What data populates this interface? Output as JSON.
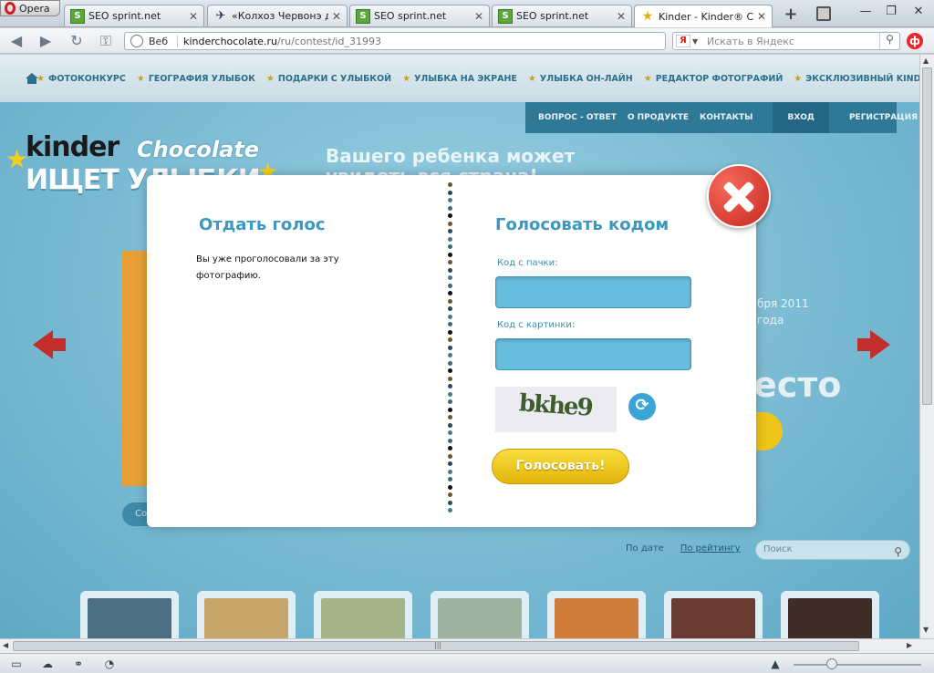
{
  "browser": {
    "menu_label": "Opera",
    "tabs": [
      {
        "title": "SEO sprint.net",
        "icon": "seo-favicon"
      },
      {
        "title": "«Колхоз Червонэ д…",
        "icon": "bird-favicon"
      },
      {
        "title": "SEO sprint.net",
        "icon": "seo-favicon"
      },
      {
        "title": "SEO sprint.net",
        "icon": "seo-favicon"
      },
      {
        "title": "Kinder - Kinder® Ch…",
        "icon": "star-favicon"
      }
    ],
    "address": {
      "label": "Веб",
      "host": "kinderchocolate.ru",
      "path": "/ru/contest/id_31993"
    },
    "search_placeholder": "Искать в Яндекс",
    "search_engine_badge": "Я"
  },
  "site": {
    "nav": [
      "ФОТОКОНКУРС",
      "ГЕОГРАФИЯ УЛЫБОК",
      "ПОДАРКИ С УЛЫБКОЙ",
      "УЛЫБКА НА ЭКРАНЕ",
      "УЛЫБКА ОН-ЛАЙН",
      "РЕДАКТОР ФОТОГРАФИЙ",
      "ЭКСКЛЮЗИВНЫЙ KINDER® CHOCOLATE"
    ],
    "usermenu": {
      "qa": "ВОПРОС - ОТВЕТ",
      "about": "О ПРОДУКТЕ",
      "contacts": "КОНТАКТЫ",
      "login": "ВХОД",
      "register": "РЕГИСТРАЦИЯ"
    },
    "logo": {
      "brand": "kinder",
      "product": "Chocolate",
      "tagline": "ИЩЕТ УЛЫБКИ"
    },
    "headline_line1": "Вашего ребенка может",
    "headline_line2": "увидеть вся страна!",
    "date_fragment_1": "бря 2011",
    "date_fragment_2": "года",
    "place_fragment": "есто",
    "button_fragment": "Со",
    "sort": {
      "by_date": "По дате",
      "by_rating": "По рейтингу"
    },
    "search_placeholder": "Поиск"
  },
  "modal": {
    "left_title": "Отдать голос",
    "left_message": "Вы уже проголосовали за эту фотографию.",
    "right_title": "Голосовать кодом",
    "pack_code_label": "Код с пачки:",
    "pack_code_value": "",
    "image_code_label": "Код с картинки:",
    "image_code_value": "",
    "captcha_text": "bkhe9",
    "vote_button": "Голосовать!"
  },
  "colors": {
    "accent_blue": "#3b98bf",
    "input_blue": "#67bddd",
    "vote_yellow": "#f0c820",
    "close_red": "#d9352a",
    "page_bg": "#7fbcd3"
  }
}
